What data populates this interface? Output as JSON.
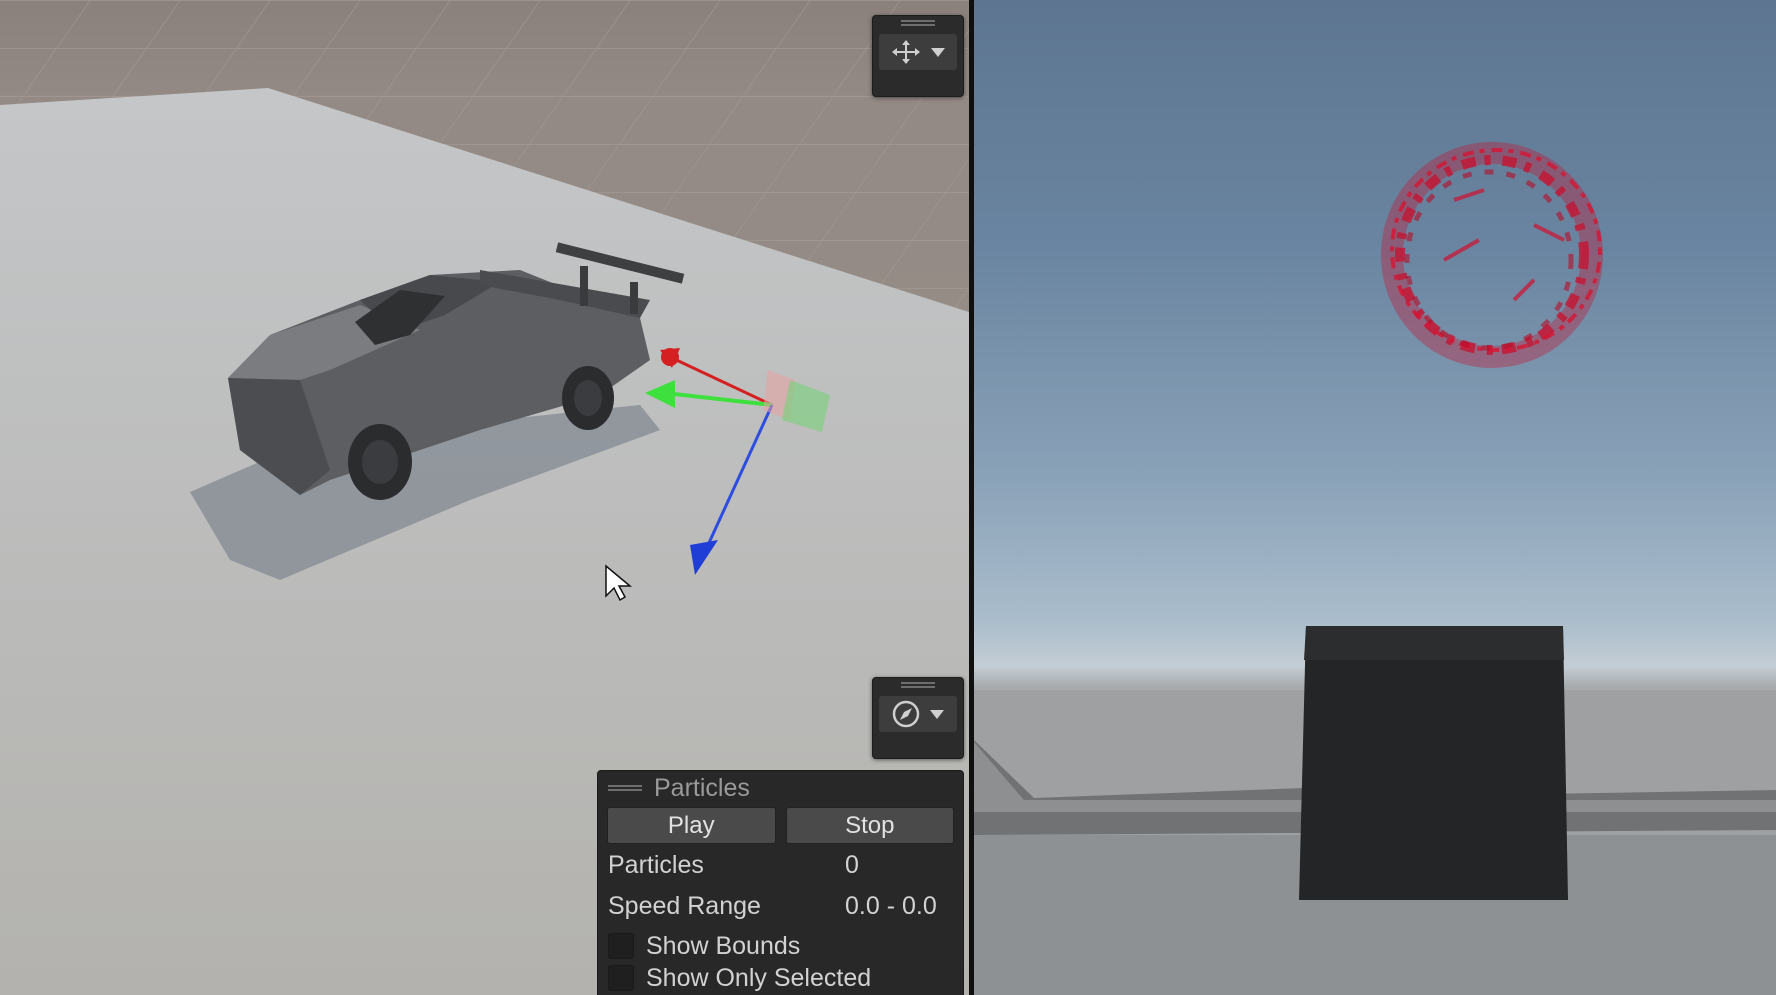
{
  "scene_toolbar": {
    "transform_tool_icon": "move-tool-icon",
    "orientation_icon": "compass-icon"
  },
  "particles_panel": {
    "title": "Particles",
    "play_label": "Play",
    "stop_label": "Stop",
    "particles_label": "Particles",
    "particles_value": "0",
    "speed_range_label": "Speed Range",
    "speed_range_value": "0.0 - 0.0",
    "show_bounds_label": "Show Bounds",
    "show_only_selected_label": "Show Only Selected"
  },
  "colors": {
    "editor_panel": "#282828",
    "button": "#4a4a4a",
    "axis_x": "#d42020",
    "axis_y": "#3ee03e",
    "axis_z": "#2d4de0",
    "particles": "#c8102e"
  }
}
